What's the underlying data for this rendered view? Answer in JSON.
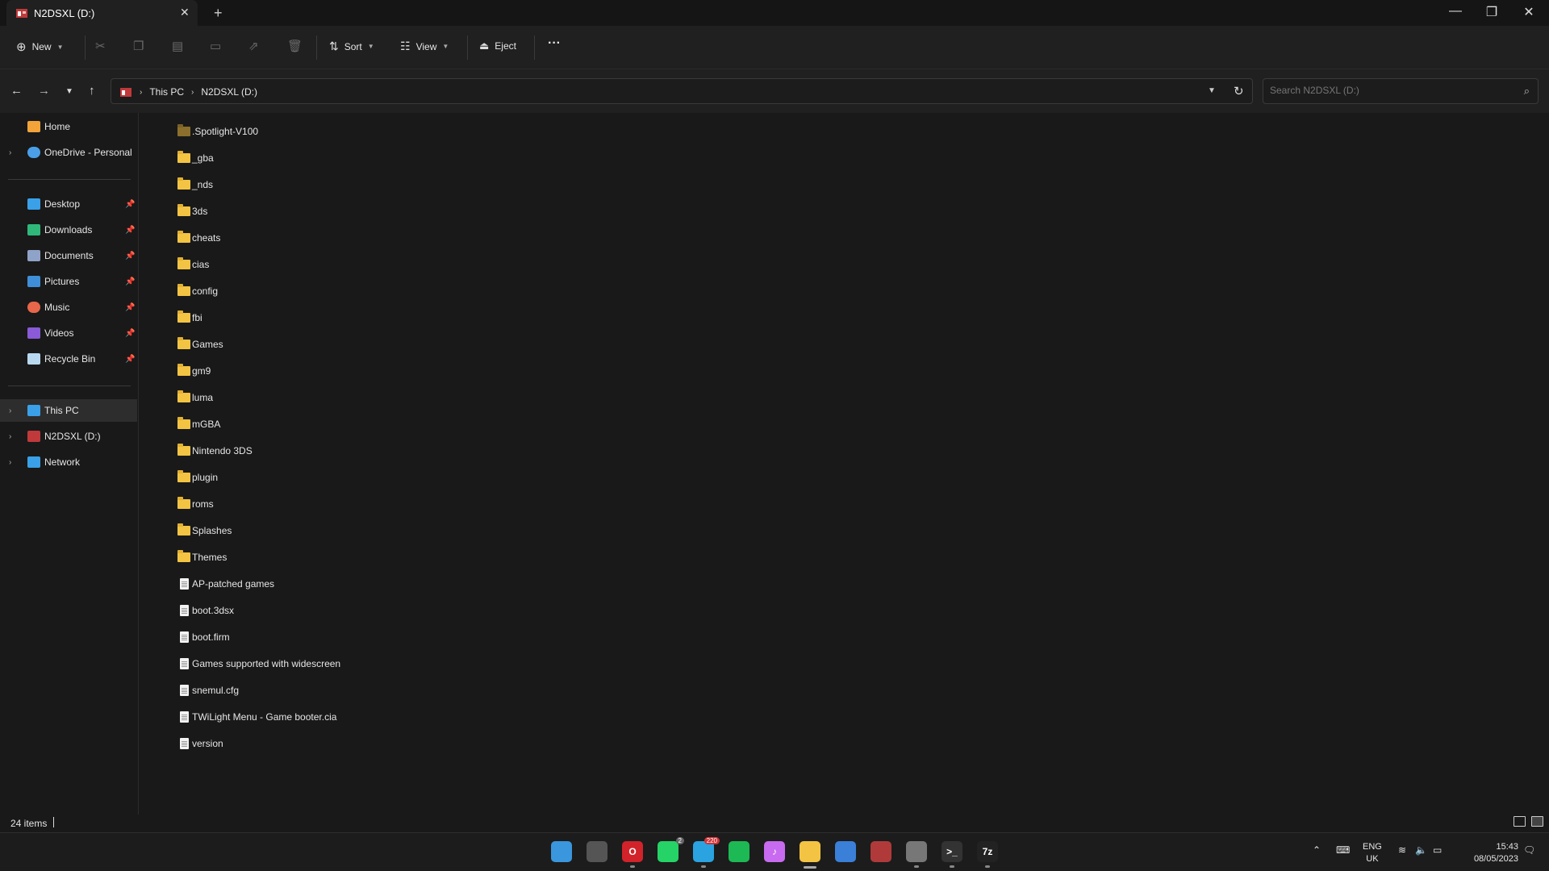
{
  "window": {
    "tab_title": "N2DSXL (D:)",
    "tab_close": "✕",
    "new_tab": "+",
    "minimize": "—",
    "maximize": "❐",
    "close": "✕"
  },
  "toolbar": {
    "new_label": "New",
    "sort_label": "Sort",
    "view_label": "View",
    "eject_label": "Eject",
    "more_label": "···"
  },
  "address": {
    "crumbs": [
      "This PC",
      "N2DSXL (D:)"
    ],
    "search_placeholder": "Search N2DSXL (D:)"
  },
  "sidebar": {
    "quick": [
      {
        "label": "Home",
        "icon": "home-icon",
        "color": "#f2a33a",
        "chevron": false
      },
      {
        "label": "OneDrive - Personal",
        "icon": "cloud-icon",
        "color": "#4a9fe8",
        "chevron": true
      }
    ],
    "pinned": [
      {
        "label": "Desktop",
        "icon": "desktop-icon",
        "color": "#3aa0e8"
      },
      {
        "label": "Downloads",
        "icon": "download-icon",
        "color": "#2fb87a"
      },
      {
        "label": "Documents",
        "icon": "documents-icon",
        "color": "#8fa2c8"
      },
      {
        "label": "Pictures",
        "icon": "pictures-icon",
        "color": "#3f8fd8"
      },
      {
        "label": "Music",
        "icon": "music-icon",
        "color": "#e8664a"
      },
      {
        "label": "Videos",
        "icon": "videos-icon",
        "color": "#8a5ad8"
      },
      {
        "label": "Recycle Bin",
        "icon": "recycle-bin-icon",
        "color": "#b8d8f0"
      }
    ],
    "devices": [
      {
        "label": "This PC",
        "icon": "computer-icon",
        "color": "#3aa0e8",
        "selected": true
      },
      {
        "label": "N2DSXL (D:)",
        "icon": "drive-icon",
        "color": "#c0393b",
        "selected": false
      },
      {
        "label": "Network",
        "icon": "network-icon",
        "color": "#3aa0e8",
        "selected": false
      }
    ]
  },
  "files": [
    {
      "name": ".Spotlight-V100",
      "type": "folder",
      "hidden": true
    },
    {
      "name": "_gba",
      "type": "folder"
    },
    {
      "name": "_nds",
      "type": "folder"
    },
    {
      "name": "3ds",
      "type": "folder"
    },
    {
      "name": "cheats",
      "type": "folder"
    },
    {
      "name": "cias",
      "type": "folder"
    },
    {
      "name": "config",
      "type": "folder"
    },
    {
      "name": "fbi",
      "type": "folder"
    },
    {
      "name": "Games",
      "type": "folder"
    },
    {
      "name": "gm9",
      "type": "folder"
    },
    {
      "name": "luma",
      "type": "folder"
    },
    {
      "name": "mGBA",
      "type": "folder"
    },
    {
      "name": "Nintendo 3DS",
      "type": "folder"
    },
    {
      "name": "plugin",
      "type": "folder"
    },
    {
      "name": "roms",
      "type": "folder"
    },
    {
      "name": "Splashes",
      "type": "folder"
    },
    {
      "name": "Themes",
      "type": "folder"
    },
    {
      "name": "AP-patched games",
      "type": "file"
    },
    {
      "name": "boot.3dsx",
      "type": "file"
    },
    {
      "name": "boot.firm",
      "type": "file"
    },
    {
      "name": "Games supported with widescreen",
      "type": "file"
    },
    {
      "name": "snemul.cfg",
      "type": "file"
    },
    {
      "name": "TWiLight Menu - Game booter.cia",
      "type": "file"
    },
    {
      "name": "version",
      "type": "file"
    }
  ],
  "status": {
    "item_count": "24 items"
  },
  "taskbar": {
    "apps": [
      {
        "name": "start-button",
        "color": "#3a96dd",
        "glyph": "",
        "dot": false
      },
      {
        "name": "task-view-button",
        "color": "#555555",
        "glyph": "",
        "dot": false
      },
      {
        "name": "opera-app",
        "color": "#d2232a",
        "glyph": "O",
        "dot": true
      },
      {
        "name": "whatsapp-app",
        "color": "#25d366",
        "glyph": "",
        "dot": false,
        "badge": "2"
      },
      {
        "name": "telegram-app",
        "color": "#2aa3e0",
        "glyph": "",
        "dot": true,
        "badge": "220"
      },
      {
        "name": "spotify-app",
        "color": "#1db954",
        "glyph": "",
        "dot": false
      },
      {
        "name": "itunes-app",
        "color": "#c86bf0",
        "glyph": "♪",
        "dot": false
      },
      {
        "name": "file-explorer-app",
        "color": "#f3c443",
        "glyph": "",
        "dot": false,
        "active": true
      },
      {
        "name": "microsoft-store-app",
        "color": "#3a7fd8",
        "glyph": "",
        "dot": false
      },
      {
        "name": "installer-app",
        "color": "#b03a3a",
        "glyph": "",
        "dot": false
      },
      {
        "name": "disk-tool-app",
        "color": "#777777",
        "glyph": "",
        "dot": true
      },
      {
        "name": "terminal-app",
        "color": "#333333",
        "glyph": ">_",
        "dot": true
      },
      {
        "name": "7zip-app",
        "color": "#222222",
        "glyph": "7z",
        "dot": true
      }
    ],
    "lang_top": "ENG",
    "lang_bottom": "UK",
    "time": "15:43",
    "date": "08/05/2023"
  }
}
